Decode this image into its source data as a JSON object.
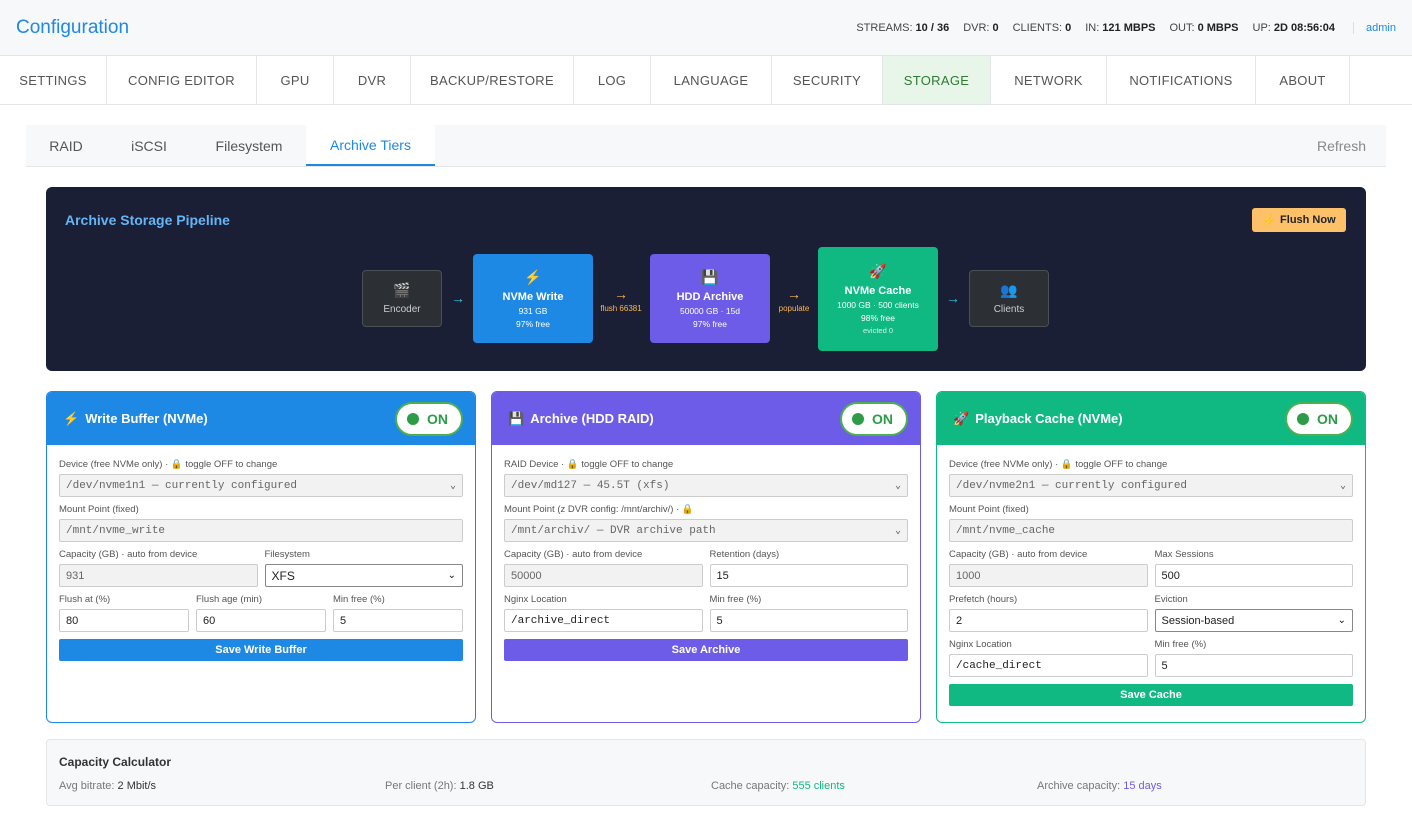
{
  "app": {
    "title": "Configuration",
    "user": "admin"
  },
  "stats": [
    {
      "label": "STREAMS:",
      "value": "10 / 36"
    },
    {
      "label": "DVR:",
      "value": "0"
    },
    {
      "label": "CLIENTS:",
      "value": "0"
    },
    {
      "label": "IN:",
      "value": "121 MBPS"
    },
    {
      "label": "OUT:",
      "value": "0 MBPS"
    },
    {
      "label": "UP:",
      "value": "2D 08:56:04"
    }
  ],
  "nav": [
    "SETTINGS",
    "CONFIG EDITOR",
    "GPU",
    "DVR",
    "BACKUP/RESTORE",
    "LOG",
    "LANGUAGE",
    "SECURITY",
    "STORAGE",
    "NETWORK",
    "NOTIFICATIONS",
    "ABOUT"
  ],
  "nav_active": "STORAGE",
  "subtabs": [
    "RAID",
    "iSCSI",
    "Filesystem",
    "Archive Tiers"
  ],
  "subtab_active": "Archive Tiers",
  "refresh_label": "Refresh",
  "pipeline": {
    "title": "Archive Storage Pipeline",
    "flush_label": "Flush Now",
    "nodes": {
      "encoder": {
        "name": "Encoder",
        "icon": "clapper-icon"
      },
      "nvme_write": {
        "name": "NVMe Write",
        "line1": "931 GB",
        "line2": "97% free",
        "icon": "lightning-icon"
      },
      "hdd_archive": {
        "name": "HDD Archive",
        "line1": "50000 GB · 15d",
        "line2": "97% free",
        "icon": "floppy-icon"
      },
      "nvme_cache": {
        "name": "NVMe Cache",
        "line1": "1000 GB · 500 clients",
        "line2": "98% free",
        "line3": "evicted 0",
        "icon": "rocket-icon"
      },
      "clients": {
        "name": "Clients",
        "icon": "users-icon"
      }
    },
    "arrows": {
      "flush": "flush 66381",
      "populate": "populate"
    }
  },
  "cards": {
    "write": {
      "title": "Write Buffer (NVMe)",
      "toggle": "ON",
      "device_label": "Device (free NVMe only) · 🔒 toggle OFF to change",
      "device_value": "/dev/nvme1n1 — currently configured",
      "mount_label": "Mount Point (fixed)",
      "mount_value": "/mnt/nvme_write",
      "capacity_label": "Capacity (GB) · auto from device",
      "capacity_value": "931",
      "fs_label": "Filesystem",
      "fs_value": "XFS",
      "flush_at_label": "Flush at (%)",
      "flush_at_value": "80",
      "flush_age_label": "Flush age (min)",
      "flush_age_value": "60",
      "min_free_label": "Min free (%)",
      "min_free_value": "5",
      "save_label": "Save Write Buffer"
    },
    "archive": {
      "title": "Archive (HDD RAID)",
      "toggle": "ON",
      "device_label": "RAID Device · 🔒 toggle OFF to change",
      "device_value": "/dev/md127 — 45.5T (xfs)",
      "mount_label": "Mount Point (z DVR config: /mnt/archiv/) · 🔒",
      "mount_value": "/mnt/archiv/ — DVR archive path",
      "capacity_label": "Capacity (GB) · auto from device",
      "capacity_value": "50000",
      "retention_label": "Retention (days)",
      "retention_value": "15",
      "nginx_label": "Nginx Location",
      "nginx_value": "/archive_direct",
      "min_free_label": "Min free (%)",
      "min_free_value": "5",
      "save_label": "Save Archive"
    },
    "cache": {
      "title": "Playback Cache (NVMe)",
      "toggle": "ON",
      "device_label": "Device (free NVMe only) · 🔒 toggle OFF to change",
      "device_value": "/dev/nvme2n1 — currently configured",
      "mount_label": "Mount Point (fixed)",
      "mount_value": "/mnt/nvme_cache",
      "capacity_label": "Capacity (GB) · auto from device",
      "capacity_value": "1000",
      "max_sessions_label": "Max Sessions",
      "max_sessions_value": "500",
      "prefetch_label": "Prefetch (hours)",
      "prefetch_value": "2",
      "eviction_label": "Eviction",
      "eviction_value": "Session-based",
      "nginx_label": "Nginx Location",
      "nginx_value": "/cache_direct",
      "min_free_label": "Min free (%)",
      "min_free_value": "5",
      "save_label": "Save Cache"
    }
  },
  "calculator": {
    "title": "Capacity Calculator",
    "avg_bitrate_label": "Avg bitrate:",
    "avg_bitrate_value": "2 Mbit/s",
    "per_client_label": "Per client (2h):",
    "per_client_value": "1.8 GB",
    "cache_capacity_label": "Cache capacity:",
    "cache_capacity_value": "555 clients",
    "archive_capacity_label": "Archive capacity:",
    "archive_capacity_value": "15 days"
  },
  "colors": {
    "write": "#1e88e5",
    "archive": "#6c5ce7",
    "cache": "#10b981",
    "accent": "#1e88e5"
  }
}
